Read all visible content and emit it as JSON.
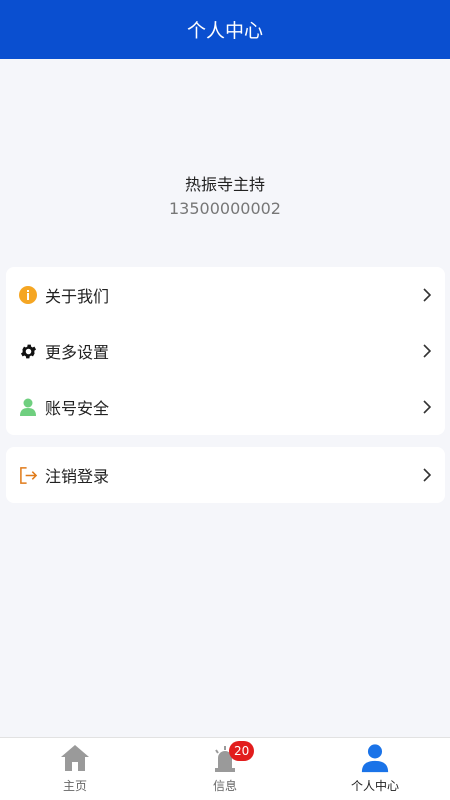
{
  "header": {
    "title": "个人中心"
  },
  "profile": {
    "name": "热振寺主持",
    "phone": "13500000002"
  },
  "menu": {
    "items": [
      {
        "label": "关于我们",
        "icon": "info-icon"
      },
      {
        "label": "更多设置",
        "icon": "gear-icon"
      },
      {
        "label": "账号安全",
        "icon": "user-icon"
      }
    ]
  },
  "logout": {
    "label": "注销登录",
    "icon": "logout-icon"
  },
  "tabbar": {
    "tabs": [
      {
        "label": "主页",
        "icon": "home-icon"
      },
      {
        "label": "信息",
        "icon": "alarm-icon",
        "badge": "20"
      },
      {
        "label": "个人中心",
        "icon": "person-icon",
        "active": true
      }
    ]
  },
  "colors": {
    "header_bg": "#0a4fd0",
    "active_tab": "#1a73e8",
    "badge": "#e21d1d",
    "info": "#f5a623",
    "user": "#6fcf7f",
    "logout": "#e07b1a"
  }
}
